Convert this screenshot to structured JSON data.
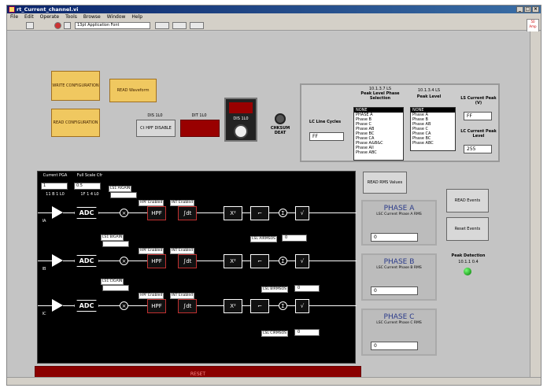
{
  "window": {
    "title": "rt_Current_channel.vi"
  },
  "menu": [
    "File",
    "Edit",
    "Operate",
    "Tools",
    "Browse",
    "Window",
    "Help"
  ],
  "toolbar": {
    "font": "13pt Application Font"
  },
  "help": "50 Amp",
  "buttons": {
    "write": "WRITE CONFIGURATION",
    "read": "READ CONFIGURATION",
    "read_waveform": "READ Waveform",
    "read_rms": "READ RMS Values",
    "read_events": "READ Events",
    "reset_events": "Reset Events"
  },
  "top": {
    "hpf_label": "DIS 1L0",
    "hpf_btn": "Ct HPF DISABLE",
    "dif_label": "DIT 1L0",
    "dif_red": "",
    "sw_label": "DIS 1L0",
    "chksum": "CHKSUM DEAT",
    "reading": "",
    "cycles_label": "LC Line Cycles",
    "cycles_val": "FF",
    "peak_sel_title": "Peak Level Phase Selection",
    "peak_sel_addr": "10.1.3.7 LS",
    "peak_sel_items": [
      "NONE",
      "PHASE A",
      "Phase B",
      "Phase C",
      "Phase AB",
      "Phase BC",
      "Phase CA",
      "Phase A&B&C",
      "Phase All",
      "Phase ABC"
    ],
    "peak_lvl_title": "Peak Level",
    "peak_lvl_addr": "10.1.3.4 LS",
    "peak_lvl_items": [
      "NONE",
      "Phase A",
      "Phase B",
      "Phase AB",
      "Phase C",
      "Phase CA",
      "Phase BC",
      "Phase ABC"
    ],
    "cur_peak_label": "LS Current Peak (V)",
    "cur_peak_val": "FF",
    "cur_peak_lvl_label": "LC Current Peak Level",
    "cur_peak_lvl_val": "255"
  },
  "diagram": {
    "gain_label": "Current PGA",
    "gain_val": "1",
    "fullscale_label": "Full Scale Cfr",
    "fullscale_val": "0.5",
    "gain_reg": "11 B 1 L0",
    "fs_reg": "1F 1 4 L0",
    "ch": [
      {
        "name": "IA",
        "gain_label": "LS1 AIGAIN",
        "gain_val": "",
        "hpf_lbl": "HPF Enabled",
        "int_lbl": "INT Enabled",
        "x2": "X²",
        "dot": "",
        "rms_lbl": "LSL AIRMSOS",
        "rms_val": "0"
      },
      {
        "name": "IB",
        "gain_label": "LS1 BIGAIN",
        "gain_val": "",
        "hpf_lbl": "HPF Enabled",
        "int_lbl": "INT Enabled",
        "x2": "X²",
        "dot": "",
        "rms_lbl": "LSL BIRMSOS",
        "rms_val": "0"
      },
      {
        "name": "IC",
        "gain_label": "LS1 CIGAIN",
        "gain_val": "",
        "hpf_lbl": "HPF Enabled",
        "int_lbl": "INT Enabled",
        "x2": "X²",
        "dot": "",
        "rms_lbl": "LSL CIRMSOS",
        "rms_val": "0"
      }
    ],
    "adc": "ADC",
    "sqrt": "√",
    "sigma": "Σ"
  },
  "phases": [
    {
      "title": "PHASE A",
      "sub": "LSC Current Phase A RMS",
      "val": "0"
    },
    {
      "title": "PHASE B",
      "sub": "LSC Current Phase B RMS",
      "val": "0"
    },
    {
      "title": "PHASE C",
      "sub": "LSC Current Phase C RMS",
      "val": "0"
    }
  ],
  "peak_detect": {
    "label": "Peak Detection",
    "addr": "10.1.1 0.4"
  },
  "status_bar": "RESET"
}
